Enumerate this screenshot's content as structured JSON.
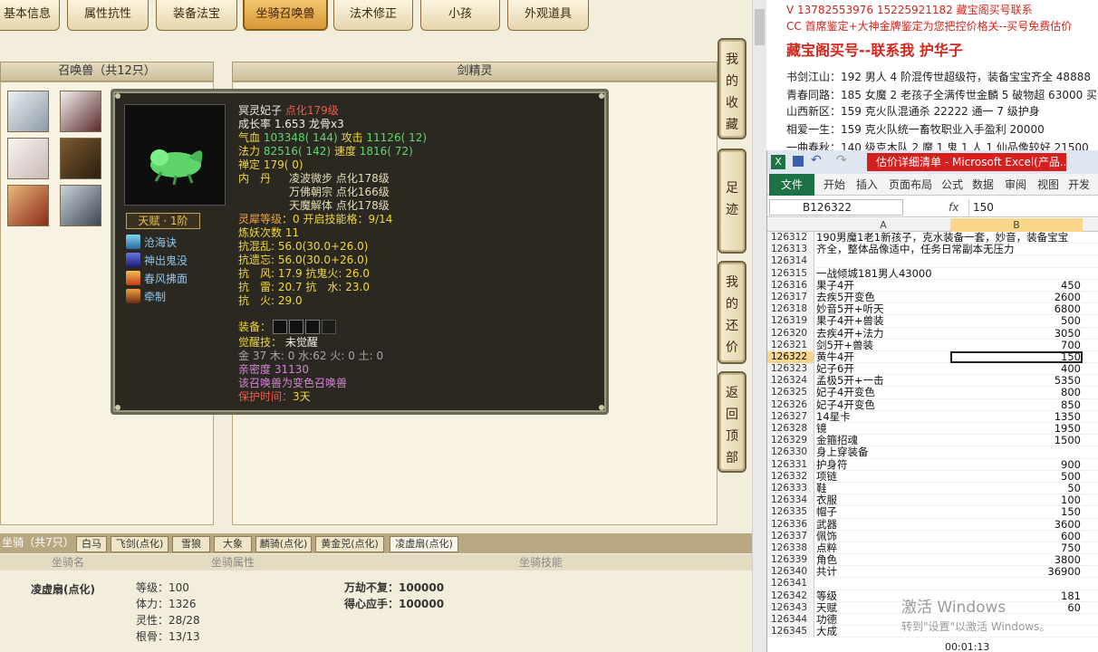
{
  "tabs": [
    "基本信息",
    "属性抗性",
    "装备法宝",
    "坐骑召唤兽",
    "法术修正",
    "小孩",
    "外观道具"
  ],
  "summon_panel": {
    "title": "召唤兽（共12只）",
    "name_header": "剑精灵"
  },
  "side_buttons": [
    "我的收藏",
    "足迹",
    "我的还价",
    "返回顶部"
  ],
  "tooltip": {
    "name": "冥灵妃子",
    "upgrade": "点化179级",
    "growth": "成长率 1.653 龙骨x3",
    "hp_label": "气血",
    "hp_value": "103348( 144)",
    "atk_label": "攻击",
    "atk_value": "11126( 12)",
    "mp_label": "法力",
    "mp_value": "82516( 142)",
    "spd_label": "速度",
    "spd_value": "1816( 72)",
    "zen": "禅定 179( 0)",
    "neidan_label": "内　丹",
    "neidan": [
      "凌波微步 点化178级",
      "万佛朝宗 点化166级",
      "天魔解体 点化178级"
    ],
    "lingxi_label": "灵犀等级",
    "lingxi_value": "：0 开启技能格：9/14",
    "lianyao": "炼妖次数 11",
    "resist": [
      "抗混乱: 56.0(30.0+26.0)",
      "抗遗忘: 56.0(30.0+26.0)",
      "抗　风: 17.9 抗鬼火: 26.0",
      "抗　雷: 20.7 抗　水: 23.0",
      "抗　火: 29.0"
    ],
    "equip_label": "装备：",
    "awaken_label": "觉醒技：",
    "awaken_value": "未觉醒",
    "elements": "金 37 木: 0 水:62 火: 0 土: 0",
    "intimacy": "亲密度 31130",
    "variant": "该召唤兽为变色召唤兽",
    "protect_label": "保护时间：",
    "protect_value": "3天",
    "tianfu": "天赋 · 1阶",
    "skills": [
      "沧海诀",
      "神出鬼没",
      "春风拂面",
      "牵制"
    ]
  },
  "mount": {
    "title": "坐骑（共7只）",
    "tabs": [
      "白马",
      "飞剑(点化)",
      "雪狼",
      "大象",
      "麟骑(点化)",
      "黄金兕(点化)",
      "凌虚扇(点化)"
    ],
    "headers": [
      "坐骑名",
      "坐骑属性",
      "坐骑技能"
    ],
    "name": "凌虚扇(点化)",
    "attrs": [
      "等级：100",
      "体力：1326",
      "灵性：28/28",
      "根骨：13/13"
    ],
    "skills": [
      "万劫不复：100000",
      "得心应手：100000"
    ]
  },
  "note": {
    "line1": "V 13782553976   15225921182   藏宝阁买号联系",
    "line2": "CC 首席鉴定+大神金牌鉴定为您把控价格关--买号免费估价",
    "headline": "藏宝阁买号--联系我   护华子",
    "items": [
      "书剑江山：192 男人 4 阶混传世超级符，装备宝宝齐全 48888",
      "青春同路：185 女魔 2 老孩子全满传世金麟 5 破物超 63000 买贵管退",
      "山西新区：159 克火队混通杀 22222 通一 7 级护身",
      "相爱一生：159 克火队统一畜牧职业入手盈利 20000",
      "一曲春秋：140 级克木队 2 魔 1 鬼 1 人 1 仙品像较好 21500"
    ]
  },
  "excel": {
    "title": "估价详细清单 - Microsoft Excel(产品...",
    "file_tab": "文件",
    "ribbon": [
      "开始",
      "插入",
      "页面布局",
      "公式",
      "数据",
      "审阅",
      "视图",
      "开发工"
    ],
    "namebox": "B126322",
    "fx": "fx",
    "formula_value": "150",
    "col_a": "A",
    "col_b": "B",
    "rows": [
      {
        "n": "126312",
        "a": "190男魔1老1新孩子，克水装备一套，妙音，装备宝宝",
        "b": ""
      },
      {
        "n": "126313",
        "a": "齐全，整体品像适中，任务日常副本无压力",
        "b": ""
      },
      {
        "n": "126314",
        "a": "",
        "b": ""
      },
      {
        "n": "126315",
        "a": "一战倾城181男人43000",
        "b": ""
      },
      {
        "n": "126316",
        "a": "果子4开",
        "b": "450"
      },
      {
        "n": "126317",
        "a": "去疾5开变色",
        "b": "2600"
      },
      {
        "n": "126318",
        "a": "妙音5开+听天",
        "b": "6800"
      },
      {
        "n": "126319",
        "a": "果子4开+兽装",
        "b": "500"
      },
      {
        "n": "126320",
        "a": "去疾4开+法力",
        "b": "3050"
      },
      {
        "n": "126321",
        "a": "剑5开+兽装",
        "b": "700"
      },
      {
        "n": "126322",
        "a": "黄牛4开",
        "b": "150"
      },
      {
        "n": "126323",
        "a": "妃子6开",
        "b": "400"
      },
      {
        "n": "126324",
        "a": "孟极5开+一击",
        "b": "5350"
      },
      {
        "n": "126325",
        "a": "妃子4开变色",
        "b": "800"
      },
      {
        "n": "126326",
        "a": "妃子4开变色",
        "b": "850"
      },
      {
        "n": "126327",
        "a": "14星卡",
        "b": "1350"
      },
      {
        "n": "126328",
        "a": "镜",
        "b": "1950"
      },
      {
        "n": "126329",
        "a": "金箍招魂",
        "b": "1500"
      },
      {
        "n": "126330",
        "a": "身上穿装备",
        "b": ""
      },
      {
        "n": "126331",
        "a": "护身符",
        "b": "900"
      },
      {
        "n": "126332",
        "a": "项链",
        "b": "500"
      },
      {
        "n": "126333",
        "a": "鞋",
        "b": "50"
      },
      {
        "n": "126334",
        "a": "衣服",
        "b": "100"
      },
      {
        "n": "126335",
        "a": "帽子",
        "b": "150"
      },
      {
        "n": "126336",
        "a": "武器",
        "b": "3600"
      },
      {
        "n": "126337",
        "a": "佩饰",
        "b": "600"
      },
      {
        "n": "126338",
        "a": "点粹",
        "b": "750"
      },
      {
        "n": "126339",
        "a": "角色",
        "b": "3800"
      },
      {
        "n": "126340",
        "a": "共计",
        "b": "36900"
      },
      {
        "n": "126341",
        "a": "",
        "b": ""
      },
      {
        "n": "126342",
        "a": "等级",
        "b": "181"
      },
      {
        "n": "126343",
        "a": "天赋",
        "b": "60"
      },
      {
        "n": "126344",
        "a": "功德",
        "b": ""
      },
      {
        "n": "126345",
        "a": "大成",
        "b": ""
      }
    ],
    "watermark1": "激活 Windows",
    "watermark2": "转到\"设置\"以激活 Windows。",
    "timer": "00:01:13"
  },
  "colors": {
    "tab_active": "#e3a94a",
    "tooltip_bg": "#2a2820",
    "excel_green": "#1e7145",
    "alert_red": "#d61f1f"
  }
}
